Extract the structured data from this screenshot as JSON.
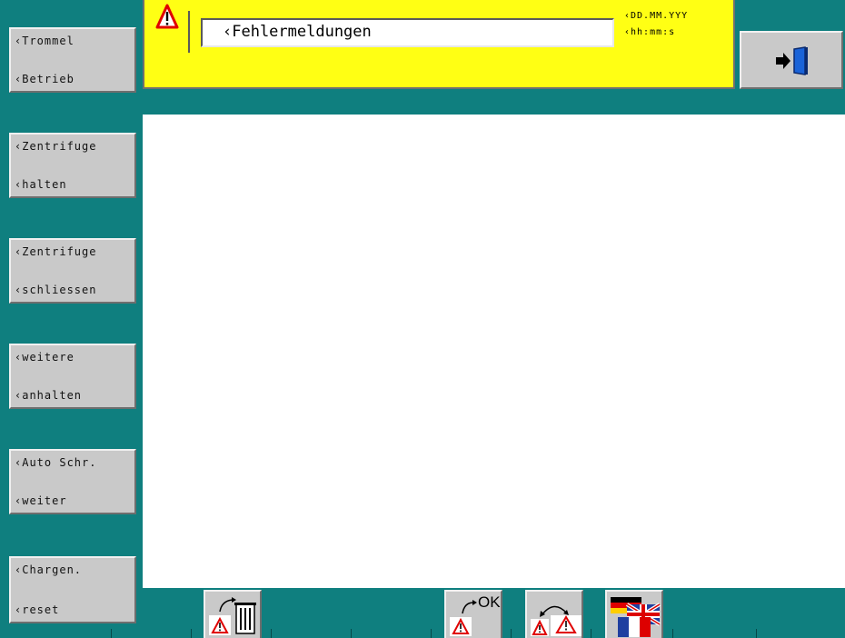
{
  "header": {
    "title": "‹Fehlermeldungen",
    "date": "‹DD.MM.YYY",
    "time": "‹hh:mm:s"
  },
  "sidebar": {
    "buttons": [
      {
        "line1": "‹Trommel",
        "line2": "‹Betrieb"
      },
      {
        "line1": "‹Zentrifuge",
        "line2": "‹halten"
      },
      {
        "line1": "‹Zentrifuge",
        "line2": "‹schliessen"
      },
      {
        "line1": "‹weitere",
        "line2": "‹anhalten"
      },
      {
        "line1": "‹Auto Schr.",
        "line2": "‹weiter"
      },
      {
        "line1": "‹Chargen.",
        "line2": "‹reset"
      }
    ]
  },
  "toolbar": {
    "ok_label": "OK"
  },
  "icons": {
    "warning": "warning-triangle-icon",
    "exit": "exit-door-icon",
    "delete": "delete-alarms-icon",
    "acknowledge": "acknowledge-ok-icon",
    "switch": "switch-alarms-icon",
    "language": "language-flags-icon"
  },
  "colors": {
    "background": "#0f7f7f",
    "header": "#ffff14",
    "button": "#c9c9c9",
    "warning": "#e00000"
  }
}
